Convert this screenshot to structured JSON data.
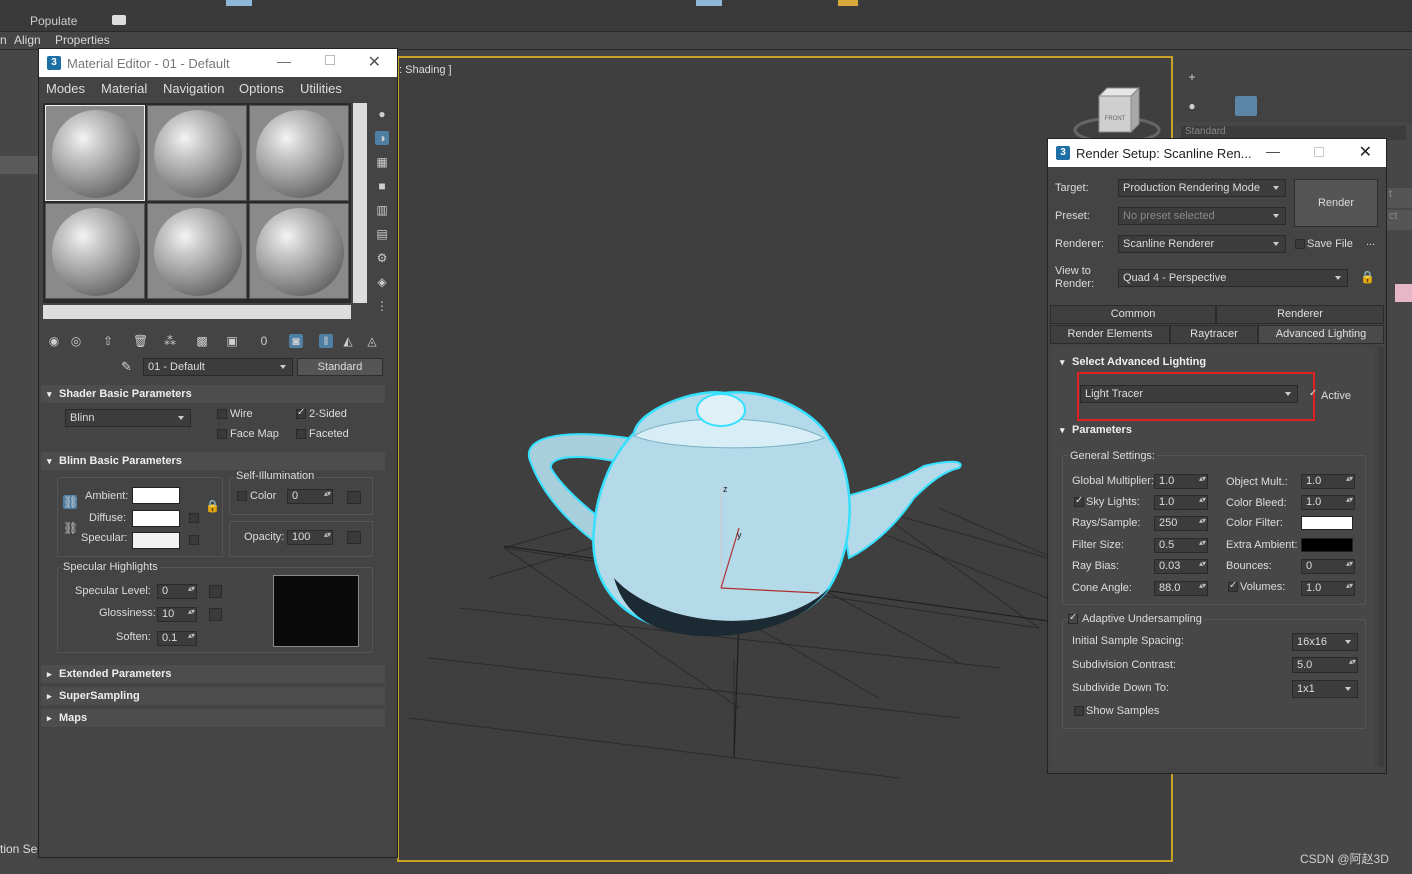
{
  "topbar": {
    "populate": "Populate"
  },
  "ribbon": {
    "items": [
      "n",
      "Align",
      "Properties"
    ]
  },
  "left_strip": {
    "bottom_text": "tion Se"
  },
  "viewport": {
    "label": ": Shading ]",
    "viewcube_face": "FRONT",
    "axis_z": "z",
    "axis_y": "y"
  },
  "command_panel": {
    "dropdown_text": "Standard",
    "partial_buttons": [
      "t",
      "ct"
    ]
  },
  "material_editor": {
    "title": "Material Editor - 01 - Default",
    "menu": [
      "Modes",
      "Material",
      "Navigation",
      "Options",
      "Utilities"
    ],
    "material_name": "01 - Default",
    "material_type": "Standard",
    "shader_basic": {
      "header": "Shader Basic Parameters",
      "shader": "Blinn",
      "wire": "Wire",
      "two_sided": "2-Sided",
      "face_map": "Face Map",
      "faceted": "Faceted"
    },
    "blinn_basic": {
      "header": "Blinn Basic Parameters",
      "self_illum": "Self-Illumination",
      "color_label": "Color",
      "color_value": "0",
      "ambient": "Ambient:",
      "diffuse": "Diffuse:",
      "specular": "Specular:",
      "opacity_label": "Opacity:",
      "opacity_value": "100",
      "highlights": "Specular Highlights",
      "spec_level": "Specular Level:",
      "spec_level_value": "0",
      "glossiness": "Glossiness:",
      "glossiness_value": "10",
      "soften": "Soften:",
      "soften_value": "0.1"
    },
    "rollouts": [
      "Extended Parameters",
      "SuperSampling",
      "Maps"
    ]
  },
  "render_setup": {
    "title": "Render Setup: Scanline Ren...",
    "target_label": "Target:",
    "target_value": "Production Rendering Mode",
    "preset_label": "Preset:",
    "preset_value": "No preset selected",
    "renderer_label": "Renderer:",
    "renderer_value": "Scanline Renderer",
    "save_file": "Save File",
    "ellipsis": "...",
    "view_label": "View to Render:",
    "view_value": "Quad 4 - Perspective",
    "render_button": "Render",
    "tabs_row1": [
      "Common",
      "Renderer"
    ],
    "tabs_row2": [
      "Render Elements",
      "Raytracer",
      "Advanced Lighting"
    ],
    "select_header": "Select Advanced Lighting",
    "light_tracer": "Light Tracer",
    "active": "Active",
    "params_header": "Parameters",
    "general_settings": "General Settings:",
    "left_params": [
      {
        "label": "Global Multiplier:",
        "value": "1.0"
      },
      {
        "label": "Sky Lights:",
        "value": "1.0"
      },
      {
        "label": "Rays/Sample:",
        "value": "250"
      },
      {
        "label": "Filter Size:",
        "value": "0.5"
      },
      {
        "label": "Ray Bias:",
        "value": "0.03"
      },
      {
        "label": "Cone Angle:",
        "value": "88.0"
      }
    ],
    "right_params": [
      {
        "label": "Object Mult.:",
        "value": "1.0"
      },
      {
        "label": "Color Bleed:",
        "value": "1.0"
      },
      {
        "label": "Color Filter:",
        "value": ""
      },
      {
        "label": "Extra Ambient:",
        "value": ""
      },
      {
        "label": "Bounces:",
        "value": "0"
      },
      {
        "label": "Volumes:",
        "value": "1.0"
      }
    ],
    "adaptive": "Adaptive Undersampling",
    "initial_spacing_label": "Initial Sample Spacing:",
    "initial_spacing_value": "16x16",
    "subdiv_contrast_label": "Subdivision Contrast:",
    "subdiv_contrast_value": "5.0",
    "subdiv_down_label": "Subdivide Down To:",
    "subdiv_down_value": "1x1",
    "show_samples": "Show Samples"
  },
  "watermark": "CSDN @阿赵3D",
  "colors": {
    "highlight_box": "#e02020",
    "teapot": "#b4d9e8",
    "selection": "#36e0ff"
  }
}
